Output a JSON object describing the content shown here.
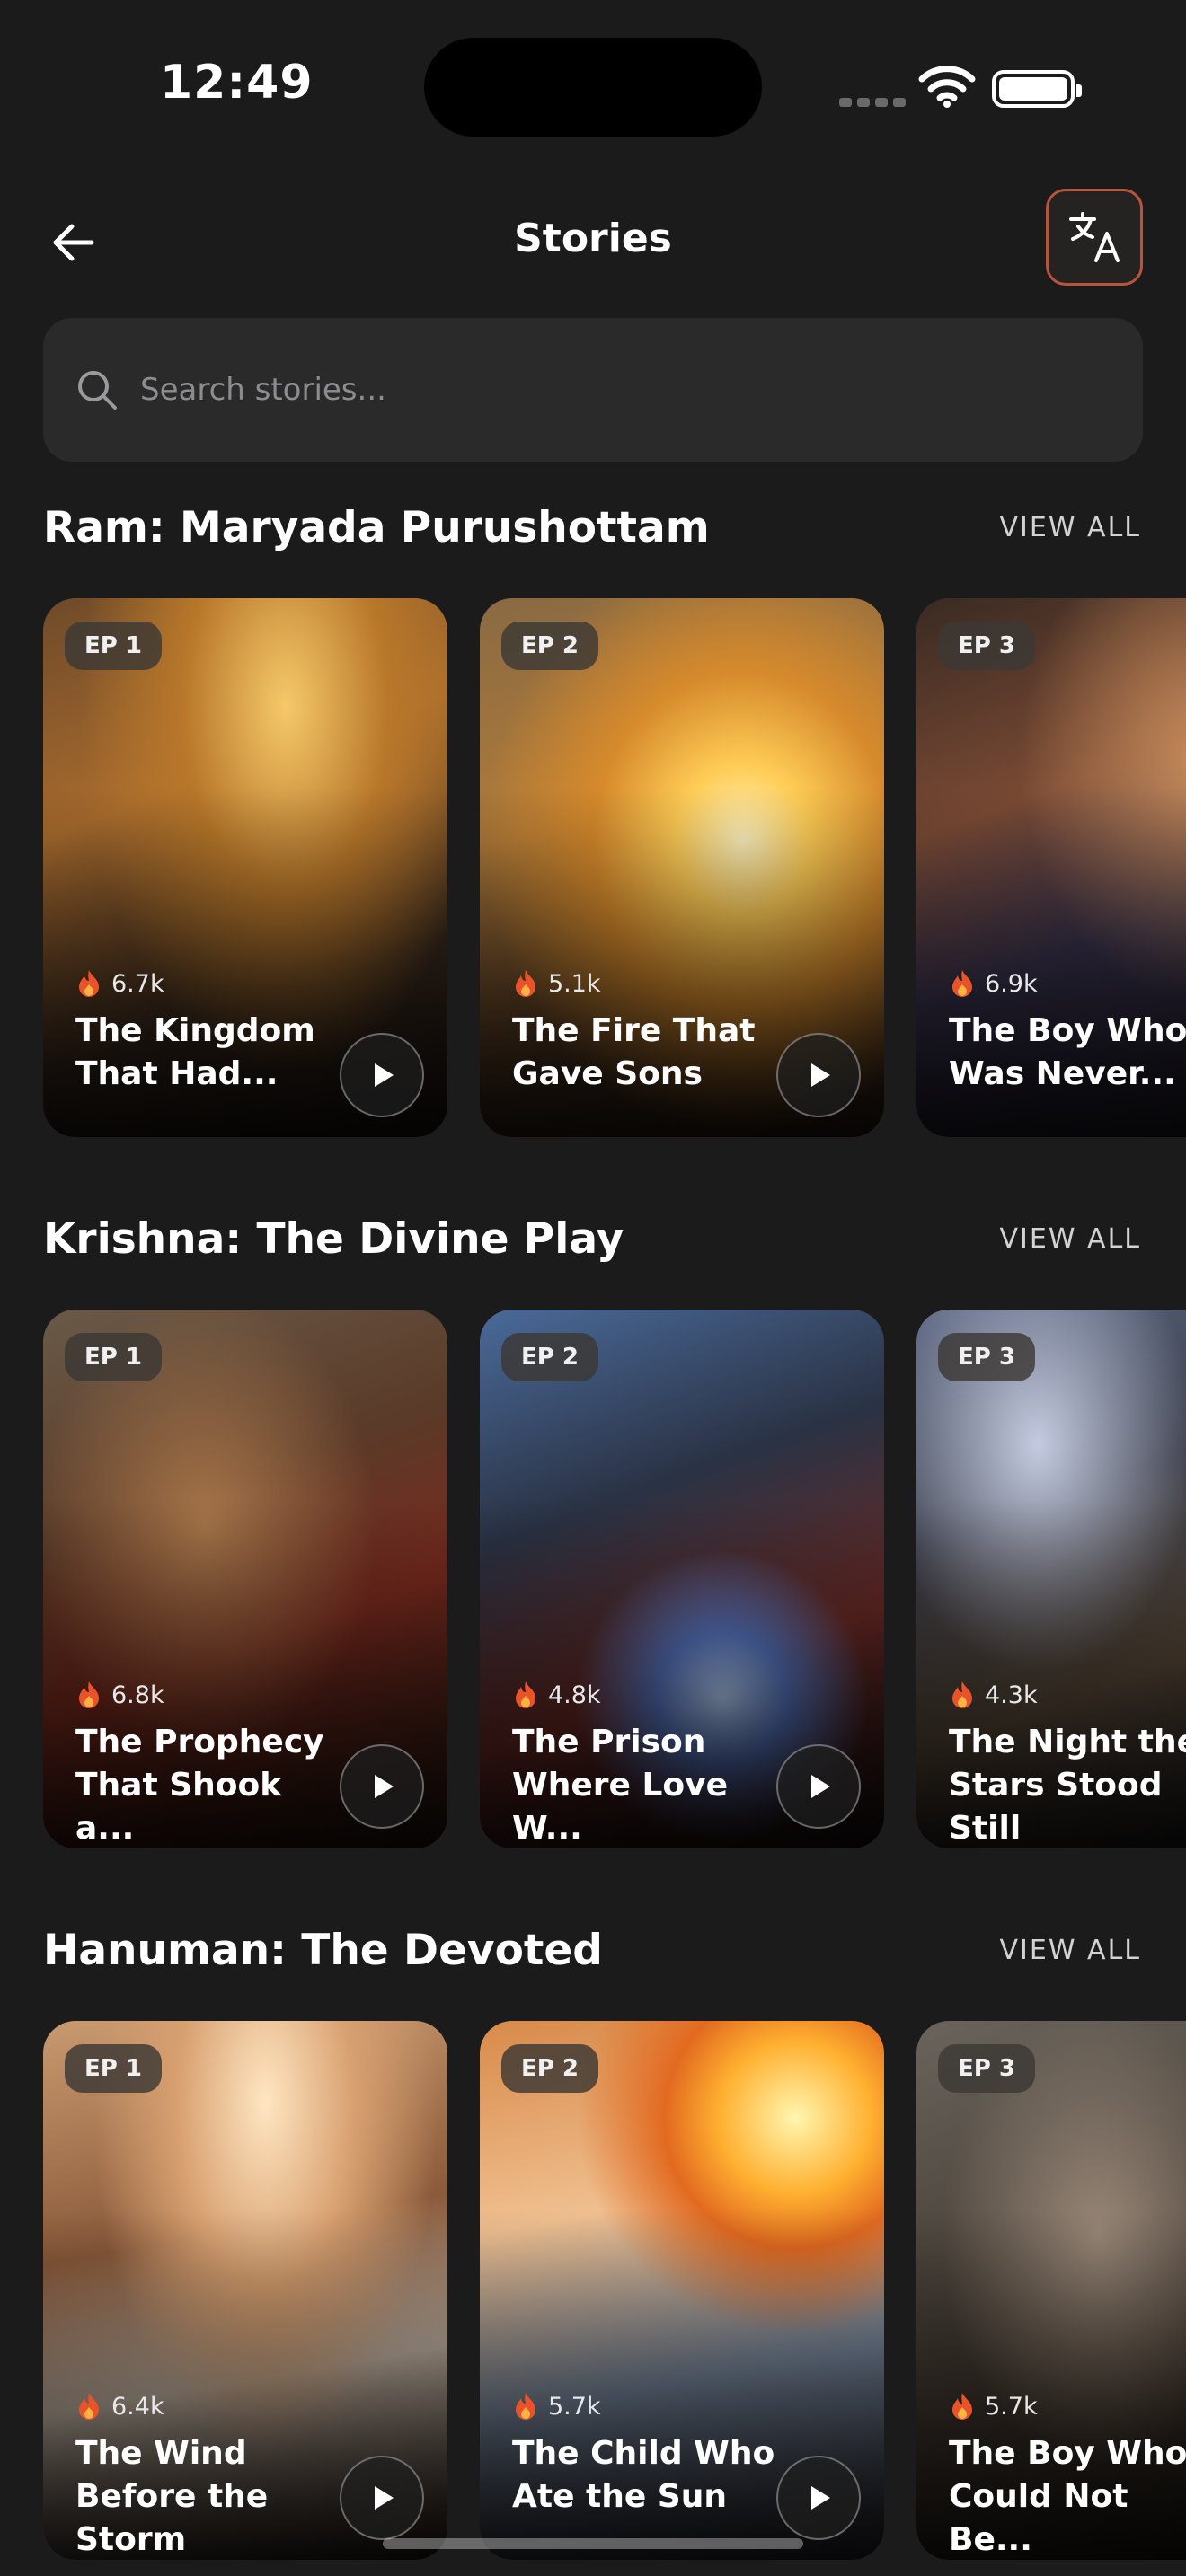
{
  "status_bar": {
    "time": "12:49"
  },
  "header": {
    "title": "Stories"
  },
  "search": {
    "placeholder": "Search stories..."
  },
  "sections": [
    {
      "title": "Ram: Maryada Purushottam",
      "view_all": "VIEW ALL",
      "cards": [
        {
          "ep": "EP 1",
          "views": "6.7k",
          "title": "The Kingdom That Had..."
        },
        {
          "ep": "EP 2",
          "views": "5.1k",
          "title": "The Fire That Gave Sons"
        },
        {
          "ep": "EP 3",
          "views": "6.9k",
          "title": "The Boy Who Was Never..."
        }
      ]
    },
    {
      "title": "Krishna: The Divine Play",
      "view_all": "VIEW ALL",
      "cards": [
        {
          "ep": "EP 1",
          "views": "6.8k",
          "title": "The Prophecy That Shook a..."
        },
        {
          "ep": "EP 2",
          "views": "4.8k",
          "title": "The Prison Where Love W..."
        },
        {
          "ep": "EP 3",
          "views": "4.3k",
          "title": "The Night the Stars Stood Still"
        }
      ]
    },
    {
      "title": "Hanuman: The Devoted",
      "view_all": "VIEW ALL",
      "cards": [
        {
          "ep": "EP 1",
          "views": "6.4k",
          "title": "The Wind Before the Storm"
        },
        {
          "ep": "EP 2",
          "views": "5.7k",
          "title": "The Child Who Ate the Sun"
        },
        {
          "ep": "EP 3",
          "views": "5.7k",
          "title": "The Boy Who Could Not Be..."
        }
      ]
    }
  ],
  "colors": {
    "background": "#1b1b1c",
    "search_bg": "#2a2a2b",
    "accent_border": "#b8533c",
    "flame": "#e8532a"
  },
  "icons": [
    "back-arrow-icon",
    "translate-icon",
    "search-icon",
    "flame-icon",
    "play-icon",
    "wifi-icon",
    "battery-icon"
  ]
}
